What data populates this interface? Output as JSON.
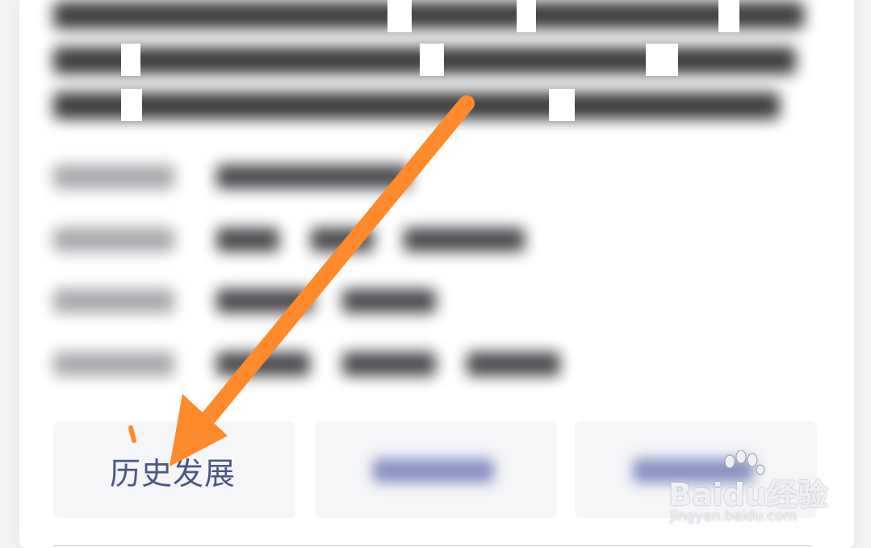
{
  "tabs": [
    {
      "label": "历史发展",
      "active": true
    },
    {
      "label": "",
      "active": false
    },
    {
      "label": "",
      "active": false
    }
  ],
  "watermark": {
    "brand": "Bai⁠du经验",
    "url": "jingyan.baidu.com"
  },
  "annotation": {
    "type": "arrow",
    "color": "#ff8a2b",
    "target": "历史发展"
  }
}
